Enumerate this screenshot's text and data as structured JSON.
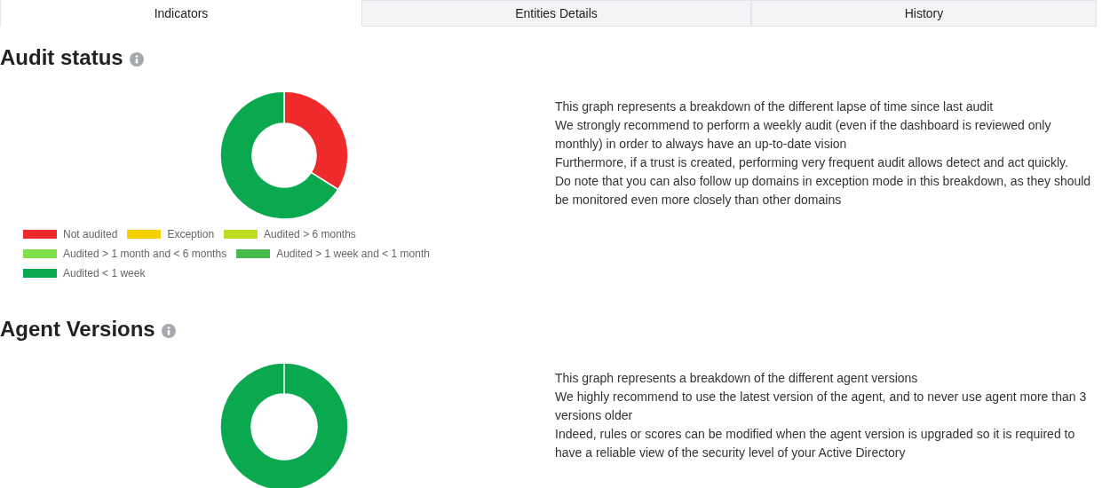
{
  "tabs": [
    {
      "label": "Indicators",
      "selected": true
    },
    {
      "label": "Entities Details",
      "selected": false
    },
    {
      "label": "History",
      "selected": false
    }
  ],
  "sections": [
    {
      "title": "Audit status",
      "description": [
        "This graph represents a breakdown of the different lapse of time since last audit",
        "We strongly recommend to perform a weekly audit (even if the dashboard is reviewed only monthly) in order to always have an up-to-date vision",
        "Furthermore, if a trust is created, performing very frequent audit allows detect and act quickly.",
        "Do note that you can also follow up domains in exception mode in this breakdown, as they should be monitored even more closely than other domains"
      ],
      "legend": [
        {
          "label": "Not audited",
          "color": "#ee2a2a"
        },
        {
          "label": "Exception",
          "color": "#f5d000"
        },
        {
          "label": "Audited > 6 months",
          "color": "#c0dc22"
        },
        {
          "label": "Audited > 1 month and < 6 months",
          "color": "#7ee04a"
        },
        {
          "label": "Audited > 1 week and < 1 month",
          "color": "#45bb4d"
        },
        {
          "label": "Audited < 1 week",
          "color": "#0aa84f"
        }
      ]
    },
    {
      "title": "Agent Versions",
      "description": [
        "This graph represents a breakdown of the different agent versions",
        "We highly recommend to use the latest version of the agent, and to never use agent more than 3 versions older",
        "Indeed, rules or scores can be modified when the agent version is upgraded so it is required to have a reliable view of the security level of your Active Directory"
      ]
    }
  ]
}
